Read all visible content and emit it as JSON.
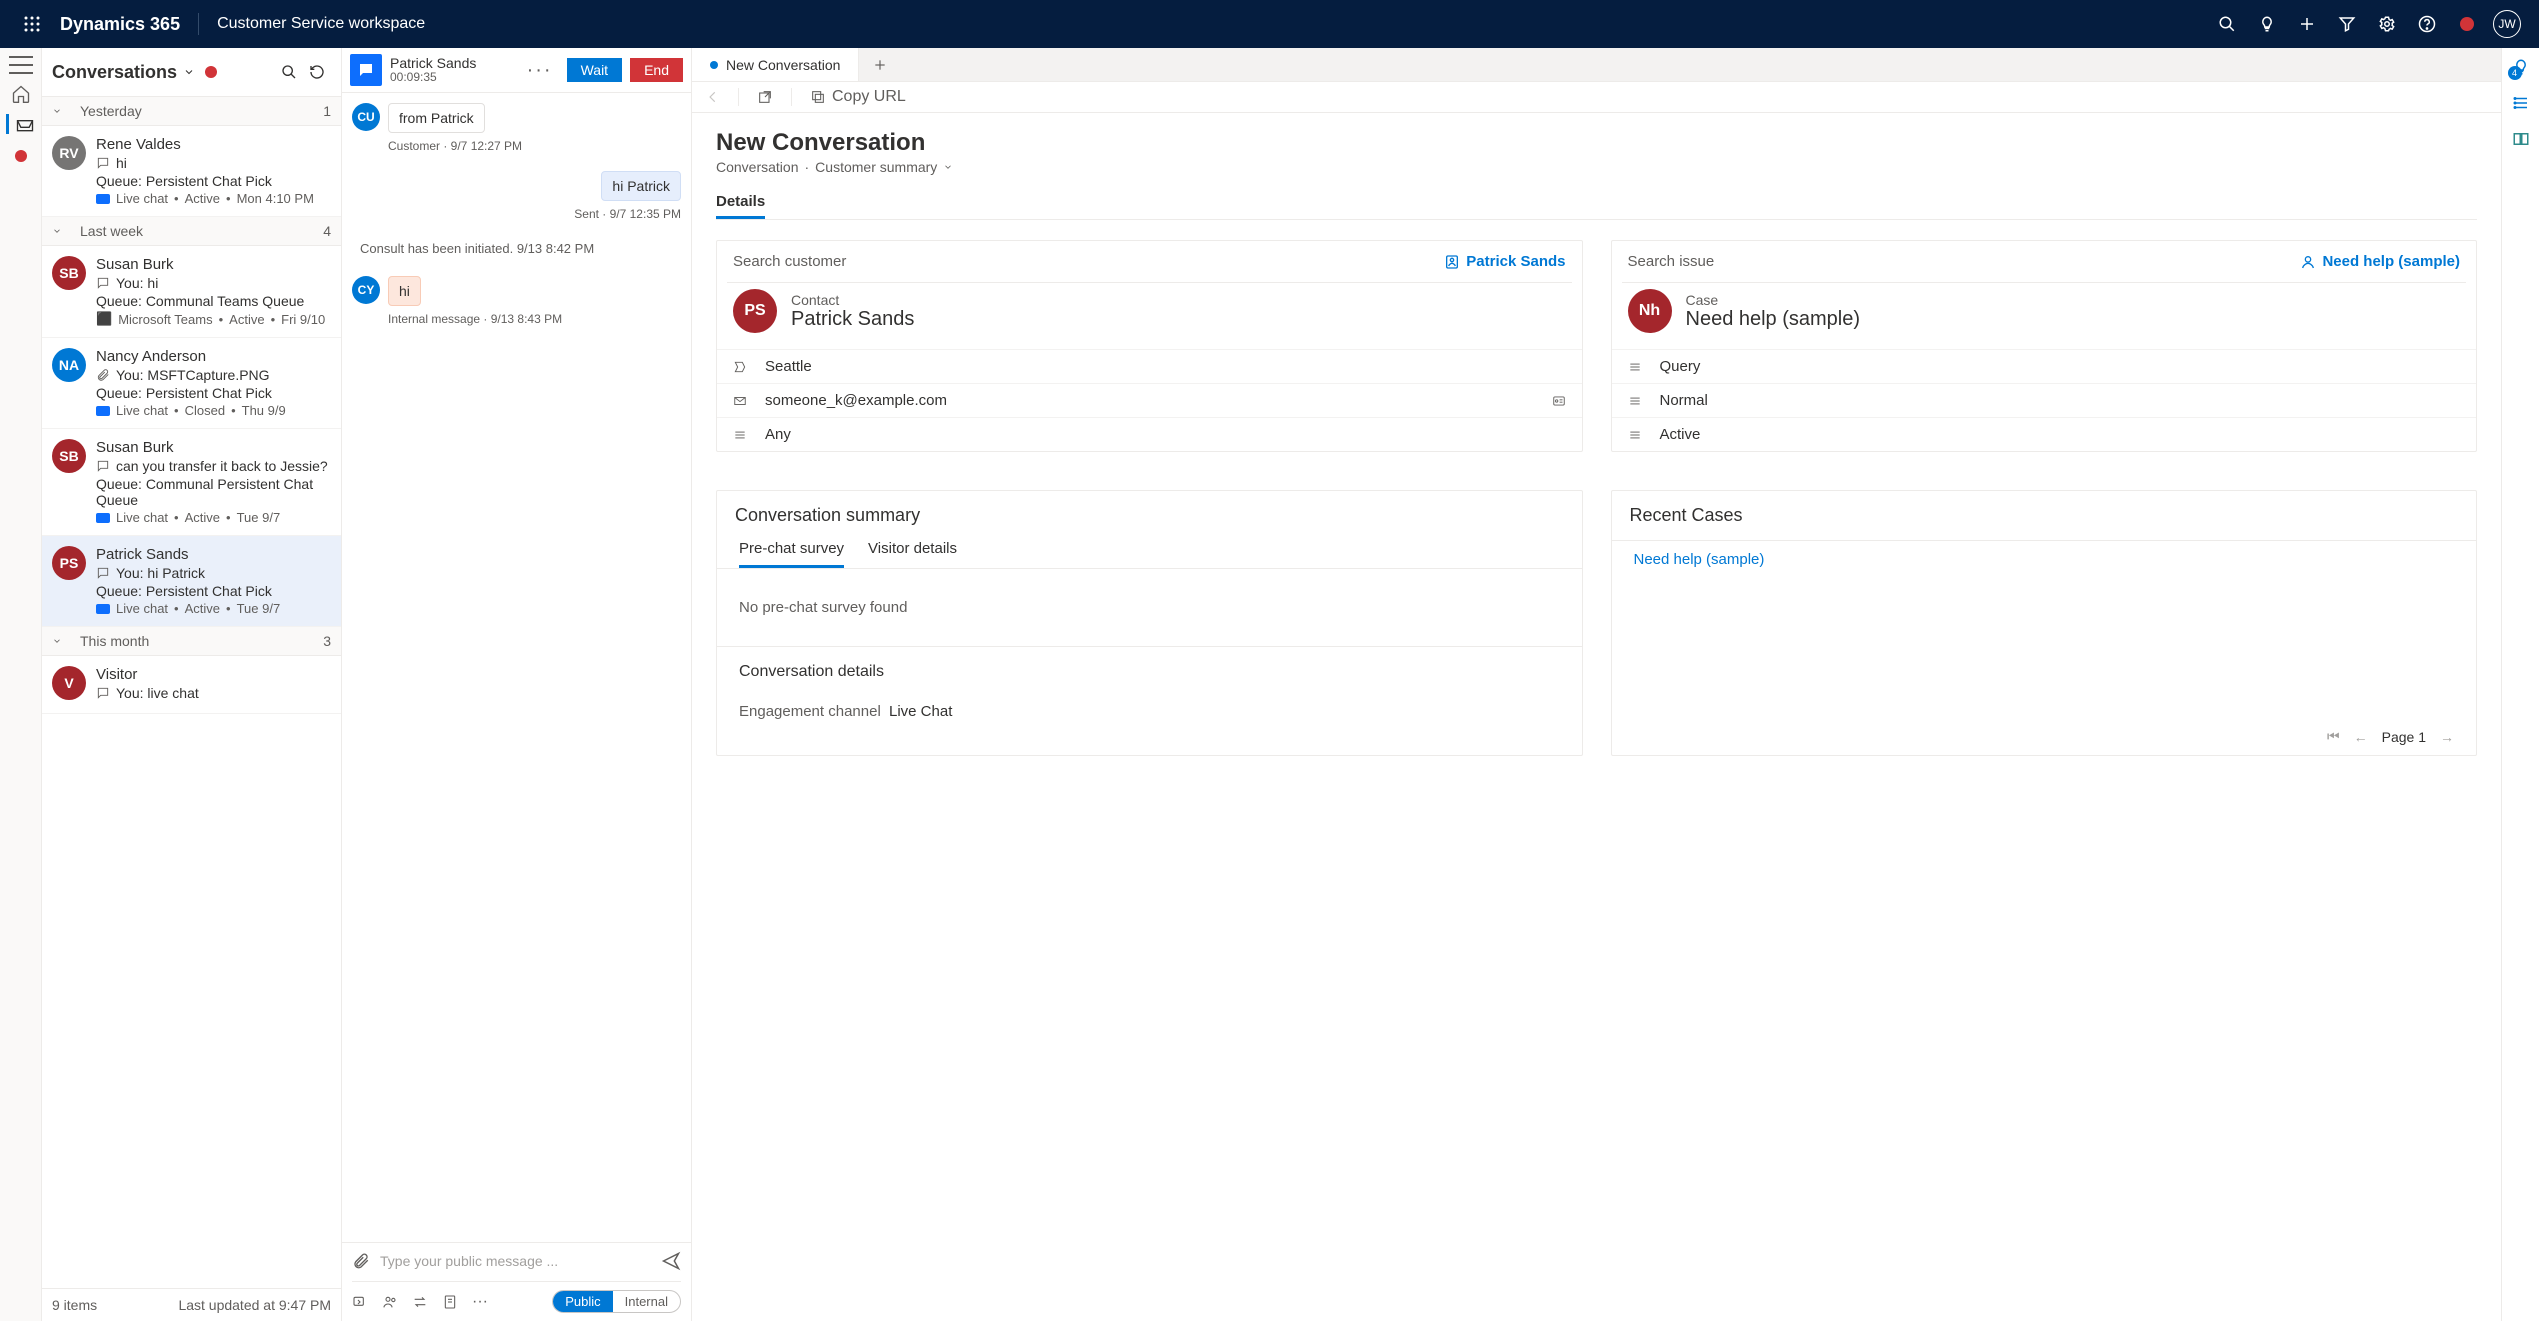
{
  "topbar": {
    "brand": "Dynamics 365",
    "workspace": "Customer Service workspace",
    "user_initials": "JW"
  },
  "conversations": {
    "title": "Conversations",
    "footer_count": "9 items",
    "footer_updated": "Last updated at 9:47 PM",
    "groups": [
      {
        "label": "Yesterday",
        "count": "1",
        "items": [
          {
            "initials": "RV",
            "color": "#767574",
            "name": "Rene Valdes",
            "preview": "hi",
            "preview_icon": "bubble",
            "queue": "Queue: Persistent Chat Pick",
            "channel": "Live chat",
            "status": "Active",
            "time": "Mon 4:10 PM",
            "selected": false
          }
        ]
      },
      {
        "label": "Last week",
        "count": "4",
        "items": [
          {
            "initials": "SB",
            "color": "#a4262c",
            "name": "Susan Burk",
            "preview": "You: hi",
            "preview_icon": "bubble",
            "queue": "Queue: Communal Teams Queue",
            "channel": "Microsoft Teams",
            "status": "Active",
            "time": "Fri 9/10",
            "selected": false
          },
          {
            "initials": "NA",
            "color": "#0078d4",
            "name": "Nancy Anderson",
            "preview": "You: MSFTCapture.PNG",
            "preview_icon": "clip",
            "queue": "Queue: Persistent Chat Pick",
            "channel": "Live chat",
            "status": "Closed",
            "time": "Thu 9/9",
            "selected": false
          },
          {
            "initials": "SB",
            "color": "#a4262c",
            "name": "Susan Burk",
            "preview": "can you transfer it back to Jessie?",
            "preview_icon": "bubble",
            "queue": "Queue: Communal Persistent Chat Queue",
            "channel": "Live chat",
            "status": "Active",
            "time": "Tue 9/7",
            "selected": false
          },
          {
            "initials": "PS",
            "color": "#a4262c",
            "name": "Patrick Sands",
            "preview": "You: hi Patrick",
            "preview_icon": "bubble",
            "queue": "Queue: Persistent Chat Pick",
            "channel": "Live chat",
            "status": "Active",
            "time": "Tue 9/7",
            "selected": true
          }
        ]
      },
      {
        "label": "This month",
        "count": "3",
        "items": [
          {
            "initials": "V",
            "color": "#a4262c",
            "name": "Visitor",
            "preview": "You: live chat",
            "preview_icon": "bubble",
            "queue": "",
            "channel": "",
            "status": "",
            "time": "",
            "selected": false
          }
        ]
      }
    ]
  },
  "chat": {
    "header_name": "Patrick Sands",
    "header_timer": "00:09:35",
    "btn_wait": "Wait",
    "btn_end": "End",
    "messages": [
      {
        "kind": "recv",
        "avatar": "CU",
        "avatar_color": "#0078d4",
        "text": "from Patrick",
        "meta": "Customer · 9/7 12:27 PM"
      },
      {
        "kind": "sent",
        "text": "hi Patrick",
        "meta": "Sent · 9/7 12:35 PM"
      },
      {
        "kind": "system",
        "text": "Consult has been initiated. 9/13 8:42 PM"
      },
      {
        "kind": "internal",
        "avatar": "CY",
        "avatar_color": "#0078d4",
        "text": "hi",
        "meta": "Internal message · 9/13 8:43 PM"
      }
    ],
    "input_placeholder": "Type your public message ...",
    "scope_public": "Public",
    "scope_internal": "Internal"
  },
  "detail": {
    "tab_label": "New Conversation",
    "copy_url": "Copy URL",
    "title": "New Conversation",
    "crumb_1": "Conversation",
    "crumb_2": "Customer summary",
    "section_details": "Details",
    "customer_card": {
      "search_label": "Search customer",
      "link": "Patrick Sands",
      "contact_label": "Contact",
      "contact_name": "Patrick Sands",
      "initials": "PS",
      "fields": [
        {
          "icon": "location",
          "value": "Seattle"
        },
        {
          "icon": "mail",
          "value": "someone_k@example.com",
          "trailing": true
        },
        {
          "icon": "list",
          "value": "Any"
        }
      ]
    },
    "issue_card": {
      "search_label": "Search issue",
      "link": "Need help (sample)",
      "case_label": "Case",
      "case_name": "Need help (sample)",
      "initials": "Nh",
      "fields": [
        {
          "icon": "list",
          "value": "Query"
        },
        {
          "icon": "list",
          "value": "Normal"
        },
        {
          "icon": "list",
          "value": "Active"
        }
      ]
    },
    "conv_summary_title": "Conversation summary",
    "conv_tabs": {
      "prechat": "Pre-chat survey",
      "visitor": "Visitor details"
    },
    "no_prechat": "No pre-chat survey found",
    "conv_details_title": "Conversation details",
    "conv_details_kv": {
      "k": "Engagement channel",
      "v": "Live Chat"
    },
    "recent_title": "Recent Cases",
    "recent_link": "Need help (sample)",
    "pager": "Page 1",
    "productivity_badge": "4"
  }
}
